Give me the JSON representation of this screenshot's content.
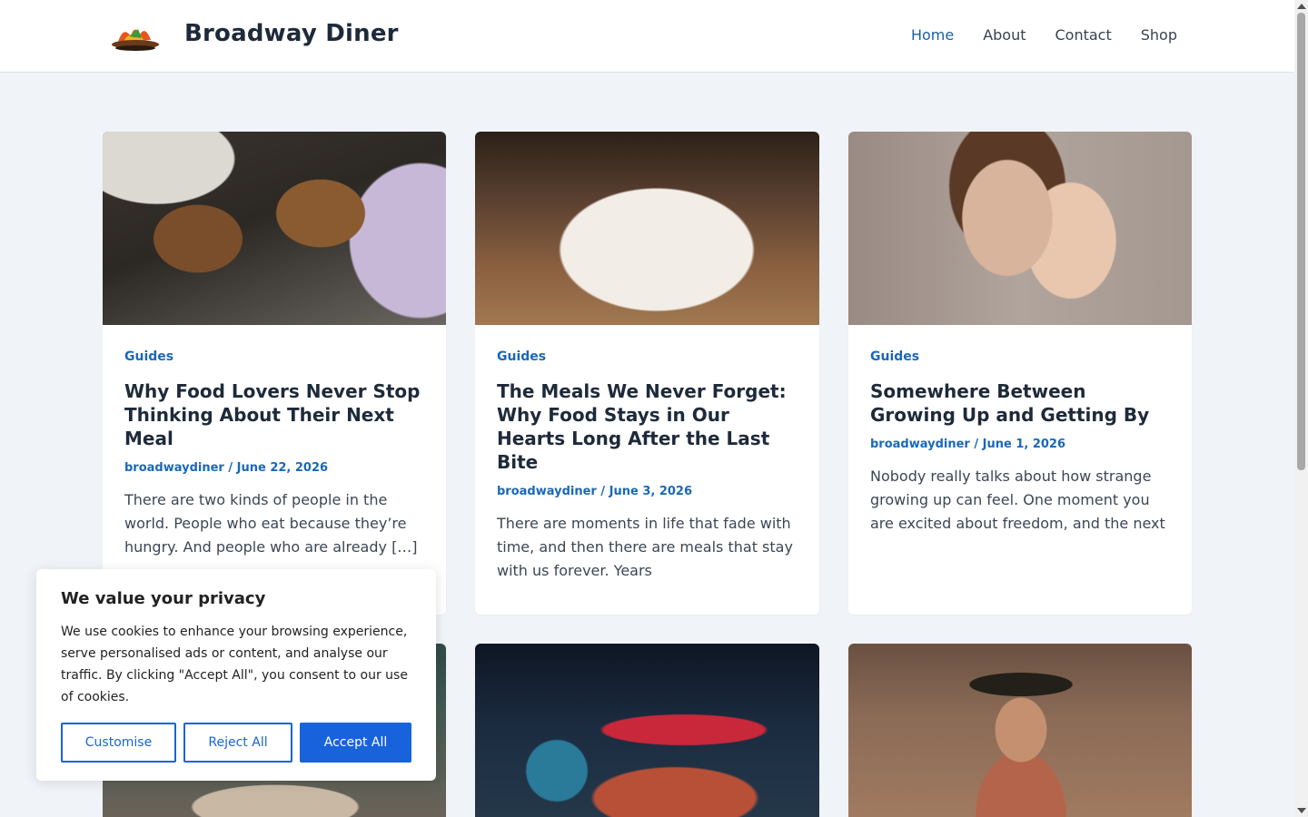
{
  "site": {
    "title": "Broadway Diner",
    "logo_icon": "flame-burger-logo"
  },
  "nav": [
    {
      "label": "Home",
      "active": true
    },
    {
      "label": "About",
      "active": false
    },
    {
      "label": "Contact",
      "active": false
    },
    {
      "label": "Shop",
      "active": false
    }
  ],
  "posts": [
    {
      "category": "Guides",
      "title": "Why Food Lovers Never Stop Thinking About Their Next Meal",
      "author": "broadwaydiner",
      "date": "June 22, 2026",
      "excerpt": "There are two kinds of people in the world. People who eat because they’re hungry. And people who are already […]"
    },
    {
      "category": "Guides",
      "title": "The Meals We Never Forget: Why Food Stays in Our Hearts Long After the Last Bite",
      "author": "broadwaydiner",
      "date": "June 3, 2026",
      "excerpt": "There are moments in life that fade with time, and then there are meals that stay with us forever. Years"
    },
    {
      "category": "Guides",
      "title": "Somewhere Between Growing Up and Getting By",
      "author": "broadwaydiner",
      "date": "June 1, 2026",
      "excerpt": "Nobody really talks about how strange growing up can feel. One moment you are excited about freedom, and the next"
    }
  ],
  "cookie": {
    "title": "We value your privacy",
    "text": "We use cookies to enhance your browsing experience, serve personalised ads or content, and analyse our traffic. By clicking \"Accept All\", you consent to our use of cookies.",
    "customise": "Customise",
    "reject": "Reject All",
    "accept": "Accept All"
  },
  "colors": {
    "accent": "#1a68b8",
    "nav_active": "#1a5fa8",
    "cookie_button": "#1863dc",
    "background": "#f0f4f8"
  }
}
